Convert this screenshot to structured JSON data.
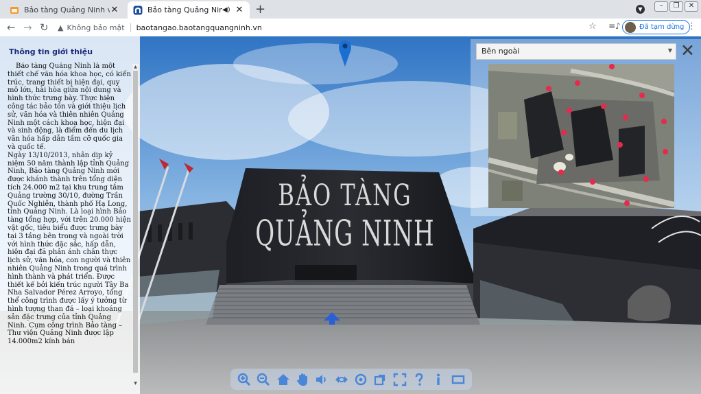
{
  "tabs": [
    {
      "title": "Bảo tàng Quảng Ninh với công tác",
      "close": "✕",
      "favicon": "orange-favicon-icon"
    },
    {
      "title": "Bảo tàng Quảng Ninh",
      "close": "✕",
      "favicon": "museum-favicon-icon",
      "audio": "speaker-icon"
    }
  ],
  "new_tab": "+",
  "toolbar": {
    "back": "←",
    "forward": "→",
    "reload": "↻",
    "security_icon": "▲",
    "security_text": "Không bảo mật",
    "url": "baotangao.baotangquangninh.vn",
    "bookmark": "☆",
    "paused_label": "Đã tạm dừng",
    "menu": "⋮"
  },
  "info_panel": {
    "title": "Thông tin giới thiệu",
    "paragraphs": [
      "Bảo tàng Quảng Ninh là một thiết chế văn hóa khoa học, có kiến trúc, trang thiết bị hiện đại, quy mô lớn, hài hòa giữa nội dung và hình thức trưng bày. Thực hiện công tác bảo tồn và giới thiệu lịch sử, văn hóa và thiên nhiên Quảng Ninh một cách khoa học, hiện đại và sinh động, là điểm đến du lịch văn hóa hấp dẫn tầm cỡ quốc gia và quốc tế.",
      "Ngày 13/10/2013, nhân dịp kỷ niệm 50 năm thành lập tỉnh Quảng Ninh, Bảo tàng Quảng Ninh mới được khánh thành trên tổng diện tích 24.000 m2 tại khu trung tâm Quảng trường 30/10, đường Trần Quốc Nghiễn, thành phố Hạ Long, tỉnh Quảng Ninh. Là loại hình Bảo tàng tổng hợp, với trên 20.000 hiện vật gốc, tiêu biểu được trưng bày tại 3 tầng bên trong và ngoài trời với hình thức đặc sắc, hấp dẫn, hiện đại đã phản ánh chân thực lịch sử, văn hóa, con người và thiên nhiên Quảng Ninh trong quá trình hình thành và phát triển. Được thiết kế bởi kiến trúc người Tây Ba Nha Salvador Pérez Arroyo, tổng thể công trình được lấy ý tưởng từ hình tượng than đá – loại khoáng sản đặc trưng của tỉnh Quảng Ninh. Cụm công trình Bảo tàng – Thư viện Quảng Ninh được lập 14.000m2 kính bán"
    ]
  },
  "building_sign": {
    "line1": "BẢO TÀNG",
    "line2": "QUẢNG NINH"
  },
  "map_panel": {
    "selected_view": "Bên ngoài",
    "close": "✕",
    "hotspot_color": "#e8294b"
  },
  "controls": [
    "zoom-in-icon",
    "zoom-out-icon",
    "home-icon",
    "hand-icon",
    "sound-icon",
    "rotate-icon",
    "reset-icon",
    "rotate-view-icon",
    "fullscreen-icon",
    "help-icon",
    "info-icon",
    "panel-icon"
  ]
}
